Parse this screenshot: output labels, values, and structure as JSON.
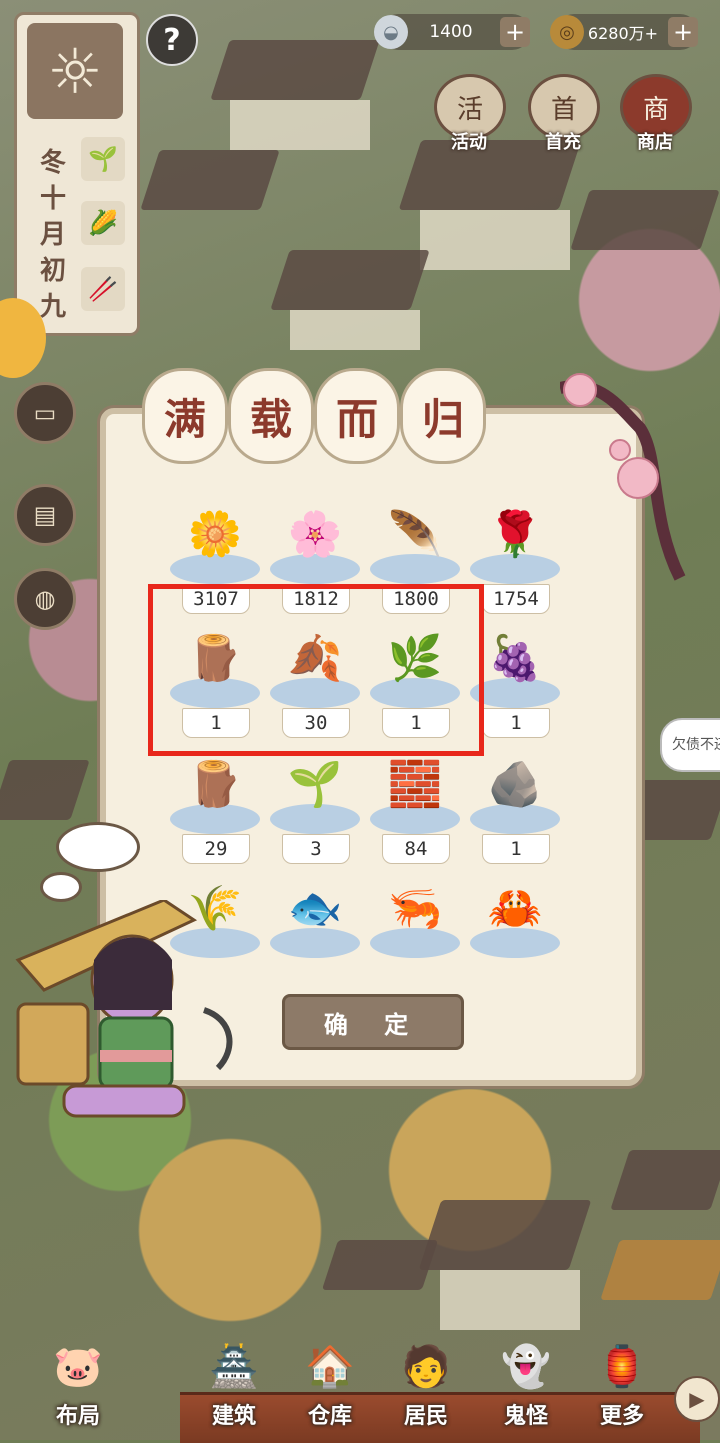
{
  "currency": {
    "silver": {
      "icon": "silver-ingot-icon",
      "value": "1400"
    },
    "coins": {
      "icon": "copper-coin-icon",
      "value": "6280万+"
    }
  },
  "top_buttons": [
    {
      "id": "activity",
      "label": "活动",
      "icon_char": "活"
    },
    {
      "id": "first_recharge",
      "label": "首充",
      "icon_char": "首"
    },
    {
      "id": "shop",
      "label": "商店",
      "icon_char": "商"
    }
  ],
  "weather": {
    "season": "冬",
    "date_chars": [
      "十",
      "月",
      "初",
      "九"
    ]
  },
  "dialog": {
    "title_chars": [
      "满",
      "载",
      "而",
      "归"
    ],
    "confirm_label": "确 定",
    "rows": [
      [
        {
          "icon": "chrysanthemum-icon",
          "glyph": "🌼",
          "count": "3107"
        },
        {
          "icon": "peony-icon",
          "glyph": "🌸",
          "count": "1812"
        },
        {
          "icon": "white-feather-plant-icon",
          "glyph": "🪶",
          "count": "1800"
        },
        {
          "icon": "yellow-rose-icon",
          "glyph": "🌹",
          "count": "1754"
        }
      ],
      [
        {
          "icon": "wood-log-icon",
          "glyph": "🪵",
          "count": "1"
        },
        {
          "icon": "ginkgo-leaf-icon",
          "glyph": "🍂",
          "count": "30"
        },
        {
          "icon": "green-herb-icon",
          "glyph": "🌿",
          "count": "1"
        },
        {
          "icon": "green-berries-icon",
          "glyph": "🍇",
          "count": "1"
        }
      ],
      [
        {
          "icon": "red-wood-icon",
          "glyph": "🪵",
          "count": "29"
        },
        {
          "icon": "sapling-icon",
          "glyph": "🌱",
          "count": "3"
        },
        {
          "icon": "stone-block-icon",
          "glyph": "🧱",
          "count": "84"
        },
        {
          "icon": "gold-ore-icon",
          "glyph": "🪨",
          "count": "1"
        }
      ],
      [
        {
          "icon": "rice-sack-icon",
          "glyph": "🌾",
          "count": ""
        },
        {
          "icon": "fish-icon",
          "glyph": "🐟",
          "count": ""
        },
        {
          "icon": "shrimp-icon",
          "glyph": "🦐",
          "count": ""
        },
        {
          "icon": "crab-icon",
          "glyph": "🦀",
          "count": ""
        }
      ]
    ]
  },
  "debt_bubble": "欠债不还",
  "nav": [
    {
      "id": "layout",
      "label": "布局",
      "glyph": "🐷"
    },
    {
      "id": "build",
      "label": "建筑",
      "glyph": "🏯"
    },
    {
      "id": "storage",
      "label": "仓库",
      "glyph": "🏠"
    },
    {
      "id": "residents",
      "label": "居民",
      "glyph": "🧑"
    },
    {
      "id": "ghosts",
      "label": "鬼怪",
      "glyph": "👻"
    },
    {
      "id": "more",
      "label": "更多",
      "glyph": "🏮"
    }
  ],
  "colors": {
    "highlight_box": "#e8271b",
    "dialog_bg": "#f6efdf",
    "title_text": "#8c3a2c",
    "confirm_button": "#8d7a68"
  }
}
